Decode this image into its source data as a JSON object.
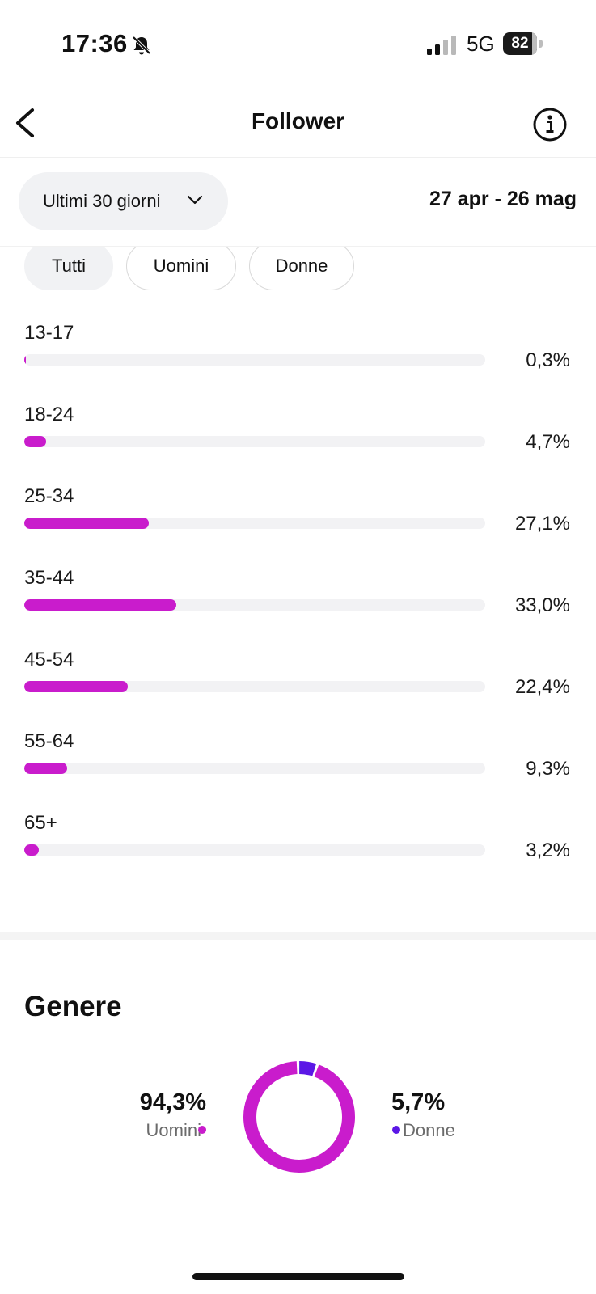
{
  "status_bar": {
    "time": "17:36",
    "network": "5G",
    "battery": "82",
    "icons": [
      "bell-slash-icon",
      "signal-icon",
      "battery-icon"
    ]
  },
  "header": {
    "title": "Follower",
    "back_icon": "chevron-left-icon",
    "info_icon": "info-icon"
  },
  "filters": {
    "date_range_label": "Ultimi 30 giorni",
    "date_range_text": "27 apr - 26 mag",
    "chips": [
      {
        "label": "Tutti",
        "active": true
      },
      {
        "label": "Uomini",
        "active": false
      },
      {
        "label": "Donne",
        "active": false
      }
    ]
  },
  "age_groups": [
    {
      "label": "13-17",
      "value_text": "0,3%",
      "fraction": 0.003
    },
    {
      "label": "18-24",
      "value_text": "4,7%",
      "fraction": 0.047
    },
    {
      "label": "25-34",
      "value_text": "27,1%",
      "fraction": 0.271
    },
    {
      "label": "35-44",
      "value_text": "33,0%",
      "fraction": 0.33
    },
    {
      "label": "45-54",
      "value_text": "22,4%",
      "fraction": 0.224
    },
    {
      "label": "55-64",
      "value_text": "9,3%",
      "fraction": 0.093
    },
    {
      "label": "65+",
      "value_text": "3,2%",
      "fraction": 0.032
    }
  ],
  "gender": {
    "title": "Genere",
    "men": {
      "label": "Uomini",
      "value_text": "94,3%",
      "fraction": 0.943,
      "color": "#c91ccc"
    },
    "women": {
      "label": "Donne",
      "value_text": "5,7%",
      "fraction": 0.057,
      "color": "#5b17e6"
    }
  },
  "colors": {
    "bar_fill": "#c91ccc",
    "bar_track": "#f2f2f4",
    "chip_active_bg": "#f1f2f4"
  }
}
